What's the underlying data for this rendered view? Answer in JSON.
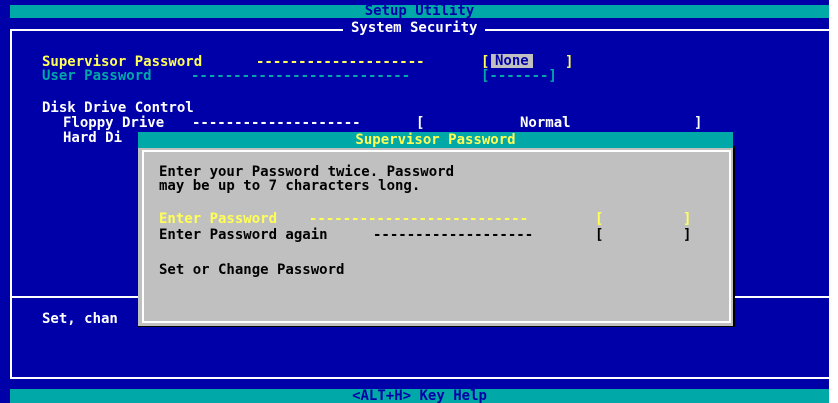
{
  "app": {
    "title": "Setup Utility"
  },
  "section": {
    "title": "System Security"
  },
  "passwords": {
    "supervisor_label": "Supervisor Password",
    "supervisor_dashes": "--------------------",
    "supervisor_open": "[",
    "supervisor_value": "None",
    "supervisor_close": "]",
    "user_label": "User Password",
    "user_dashes": "--------------------------",
    "user_value": "[-------]"
  },
  "disk": {
    "title": "Disk Drive Control",
    "floppy_label": "Floppy Drive",
    "floppy_dashes": "--------------------",
    "floppy_open": "[",
    "floppy_value": "Normal",
    "floppy_close": "]",
    "hard_label_partial": "Hard Di"
  },
  "help": {
    "text_partial": "Set, chan"
  },
  "status": {
    "hint": "<ALT+H>  Key Help"
  },
  "dialog": {
    "title": "Supervisor Password",
    "instruction_line1": "Enter your Password twice. Password",
    "instruction_line2": "may be up to 7 characters long.",
    "enter_label": "Enter Password",
    "enter_dashes": "--------------------------",
    "enter_open": "[",
    "enter_close": "]",
    "again_label": "Enter Password again",
    "again_dashes": "-------------------",
    "again_open": "[",
    "again_close": "]",
    "footer": "Set or Change Password"
  }
}
